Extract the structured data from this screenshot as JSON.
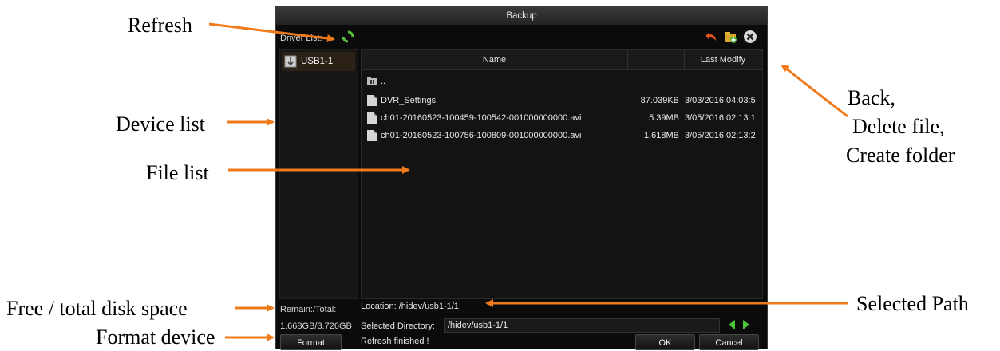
{
  "window": {
    "title": "Backup"
  },
  "driver_list_label": "Driver List:",
  "devices": [
    {
      "label": "USB1-1"
    }
  ],
  "file_table": {
    "headers": {
      "name": "Name",
      "size": "",
      "last_modify": "Last Modify"
    },
    "rows": [
      {
        "icon": "folder-up-icon",
        "name": "..",
        "size": "",
        "modified": ""
      },
      {
        "icon": "file-icon",
        "name": "DVR_Settings",
        "size": "87.039KB",
        "modified": "3/03/2016 04:03:5"
      },
      {
        "icon": "file-icon",
        "name": "ch01-20160523-100459-100542-001000000000.avi",
        "size": "5.39MB",
        "modified": "3/05/2016 02:13:1"
      },
      {
        "icon": "file-icon",
        "name": "ch01-20160523-100756-100809-001000000000.avi",
        "size": "1.618MB",
        "modified": "3/05/2016 02:13:2"
      }
    ]
  },
  "location": "Location: /hidev/usb1-1/1",
  "remain_label": "Remain:/Total:",
  "remain_value": "1.668GB/3.726GB",
  "selected_directory_label": "Selected Directory:",
  "selected_directory_value": "/hidev/usb1-1/1",
  "status": "Refresh finished !",
  "buttons": {
    "format": "Format",
    "ok": "OK",
    "cancel": "Cancel"
  },
  "icons": [
    "refresh-icon",
    "back-icon",
    "create-folder-icon",
    "delete-icon",
    "usb-drive-icon",
    "prev-arrow-icon",
    "next-arrow-icon"
  ],
  "annotations": {
    "back": "Back,",
    "delete": "Delete file,",
    "create": "Create folder",
    "refresh": "Refresh",
    "device_list": "Device list",
    "file_list": "File list",
    "free_total": "Free / total disk space",
    "format": "Format device",
    "selected_path": "Selected Path"
  },
  "colors": {
    "arrow": "#f07a1a",
    "window_bg": "#0b0b0b",
    "accent_green": "#4cc63a",
    "selection": "#2b2116"
  }
}
